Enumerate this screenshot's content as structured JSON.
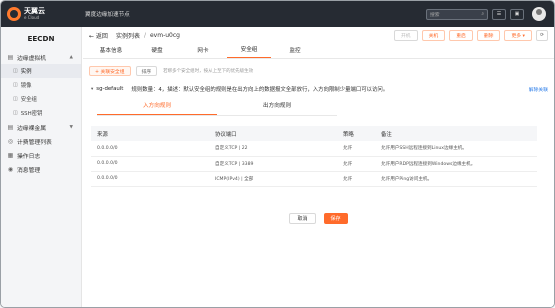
{
  "topbar": {
    "logo_main": "天翼云",
    "logo_sub": "e Cloud",
    "product": "翼度边缘加速节点",
    "search_placeholder": "搜索",
    "btn1": "☰",
    "btn2": "▣"
  },
  "sidebar": {
    "title": "EECDN",
    "group_vm": "边缘虚拟机",
    "sub_instance": "实例",
    "sub_image": "镜像",
    "sub_sg": "安全组",
    "sub_ssh": "SSH密钥",
    "group_bm": "边缘裸金属",
    "group_billing": "计费管理列表",
    "group_log": "操作日志",
    "group_msg": "消息管理"
  },
  "header": {
    "back": "← 返回",
    "crumb1": "实例列表",
    "sep": "/",
    "crumb2": "evm-u0cg",
    "btn_start": "开机",
    "btn_stop": "关机",
    "btn_restart": "重启",
    "btn_delete": "删除",
    "btn_more": "更多 ▾",
    "btn_refresh": "⟳"
  },
  "tabs": [
    "基本信息",
    "硬盘",
    "网卡",
    "安全组",
    "监控"
  ],
  "toolbar": {
    "bind": "+ 关联安全组",
    "sort": "排序",
    "hint": "若绑多个安全组时，按从上至下的优先级生效"
  },
  "sg": {
    "arrow": "▾",
    "name": "sg-default",
    "desc": "规则数量：4，描述：默认安全组的规则是在出方向上的数据报文全部放行，入方向限制少量端口可以访问。",
    "unbind": "解除关联"
  },
  "subtabs": [
    "入方向规则",
    "出方向规则"
  ],
  "table": {
    "headers": [
      "来源",
      "协议端口",
      "策略",
      "备注"
    ],
    "rows": [
      [
        "0.0.0.0/0",
        "自定义TCP | 22",
        "允许",
        "允许用户SSH远程连接到Linux边缘主机。"
      ],
      [
        "0.0.0.0/0",
        "自定义TCP | 3389",
        "允许",
        "允许用户RDP远程连接到Windows边缘主机。"
      ],
      [
        "0.0.0.0/0",
        "ICMP(IPv4) | 全部",
        "允许",
        "允许用户Ping访问主机。"
      ]
    ]
  },
  "footer": {
    "cancel": "取消",
    "save": "保存"
  }
}
